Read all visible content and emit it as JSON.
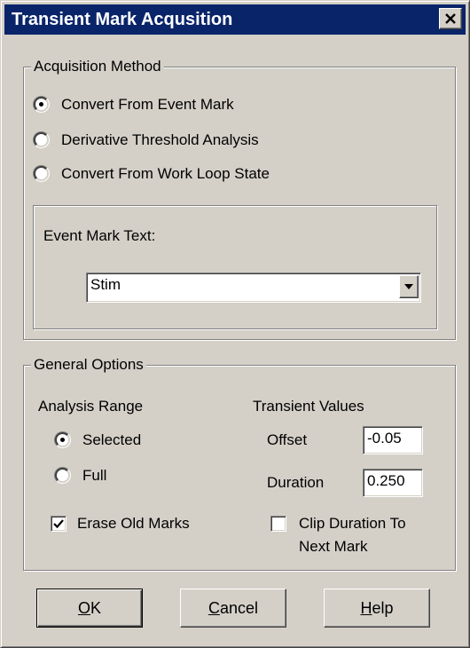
{
  "window": {
    "title": "Transient Mark Acqusition",
    "close_icon": "close-icon"
  },
  "acquisition": {
    "legend": "Acquisition Method",
    "options": [
      {
        "label": "Convert From Event Mark",
        "selected": true
      },
      {
        "label": "Derivative Threshold Analysis",
        "selected": false
      },
      {
        "label": "Convert From Work Loop State",
        "selected": false
      }
    ],
    "event_mark_label": "Event Mark Text:",
    "event_mark_value": "Stim"
  },
  "general": {
    "legend": "General Options",
    "analysis_range_label": "Analysis Range",
    "range_options": [
      {
        "label": "Selected",
        "selected": true
      },
      {
        "label": "Full",
        "selected": false
      }
    ],
    "transient_values_label": "Transient Values",
    "offset_label": "Offset",
    "offset_value": "-0.05",
    "duration_label": "Duration",
    "duration_value": "0.250",
    "erase_old_marks_label": "Erase Old Marks",
    "erase_old_marks_checked": true,
    "clip_duration_line1": "Clip Duration To",
    "clip_duration_line2": "Next Mark",
    "clip_duration_checked": false
  },
  "buttons": {
    "ok": {
      "accel": "O",
      "rest": "K"
    },
    "cancel": {
      "accel": "C",
      "rest": "ancel"
    },
    "help": {
      "accel": "H",
      "rest": "elp"
    }
  },
  "colors": {
    "titlebar": "#0a246a",
    "face": "#d4d0c8"
  }
}
